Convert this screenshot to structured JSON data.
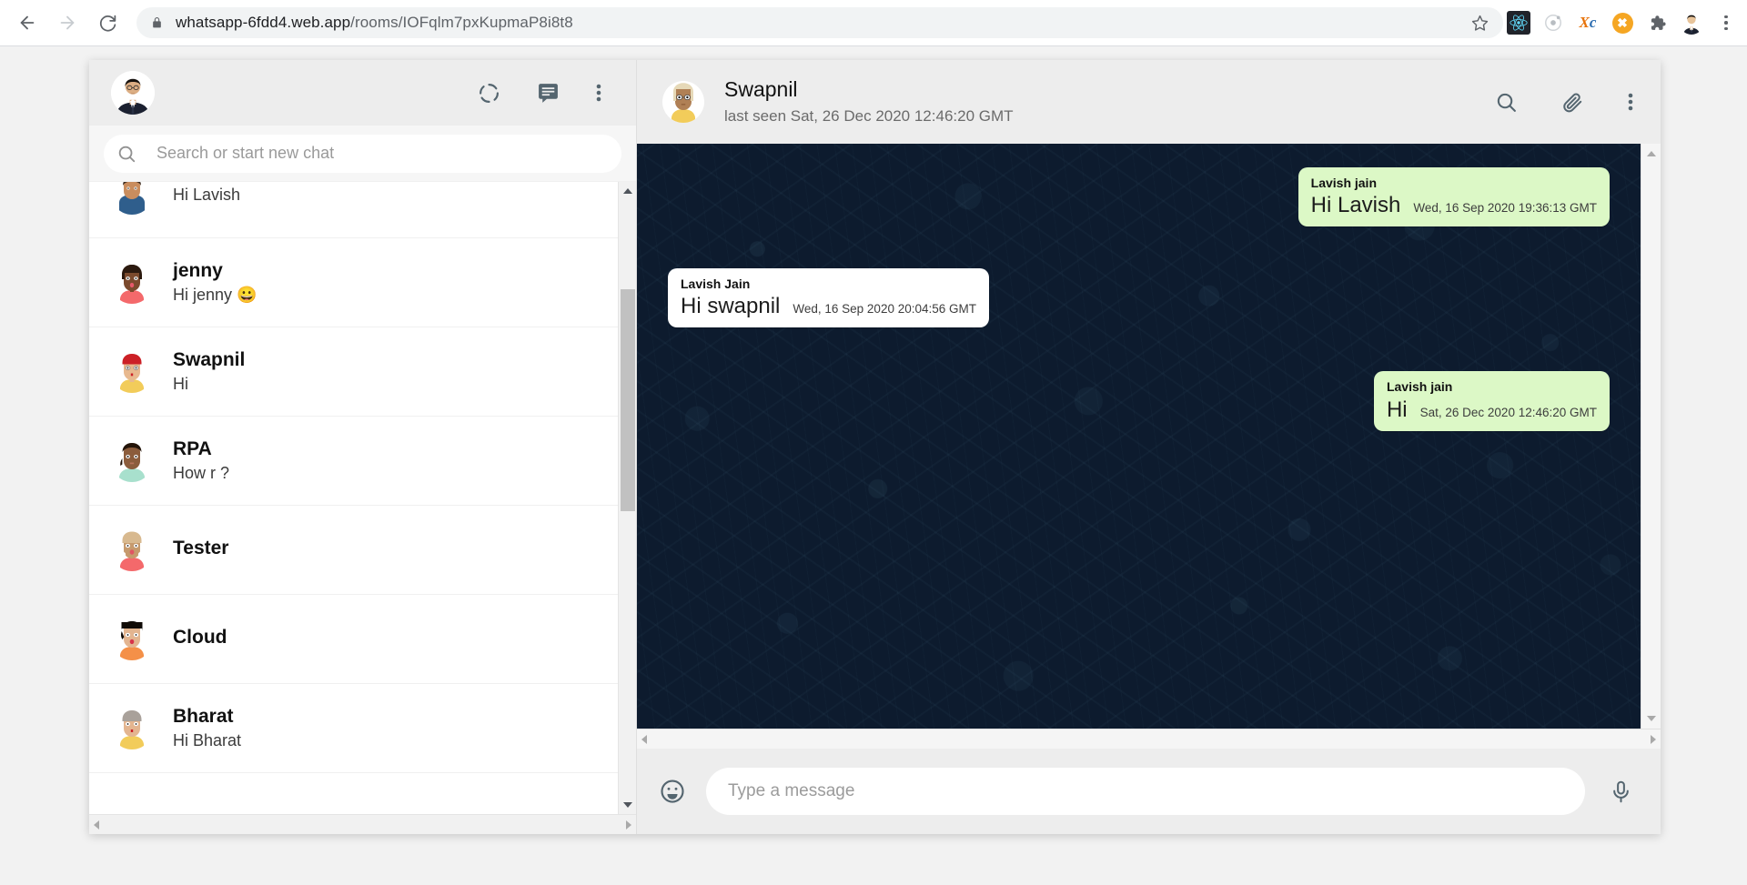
{
  "browser": {
    "back_label": "back-arrow",
    "forward_label": "forward-arrow",
    "reload_label": "reload",
    "url_display": "whatsapp-6fdd4.web.app",
    "url_path": "/rooms/IOFqlm7pxKupmaP8i8t8",
    "url_full": "whatsapp-6fdd4.web.app/rooms/IOFqlm7pxKupmaP8i8t8",
    "lock_icon": "lock-icon",
    "bookmark_icon": "star-icon",
    "extensions": [
      {
        "name": "react-devtools-icon",
        "glyph": "⚛"
      },
      {
        "name": "ionic-icon",
        "glyph": "◎"
      },
      {
        "name": "xc-extension-icon",
        "glyph": "Xc"
      },
      {
        "name": "orange-x-extension-icon",
        "glyph": "✖"
      },
      {
        "name": "puzzle-extensions-icon",
        "glyph": "❖"
      }
    ],
    "profile_icon": "user-avatar-icon",
    "menu_icon": "browser-menu-icon"
  },
  "sidebar": {
    "profile_avatar": "my-profile-avatar",
    "actions": [
      {
        "name": "status-icon",
        "label": "Status"
      },
      {
        "name": "new-chat-icon",
        "label": "New chat"
      },
      {
        "name": "menu-icon",
        "label": "Menu"
      }
    ],
    "search": {
      "icon": "search-icon",
      "placeholder": "Search or start new chat",
      "value": ""
    },
    "chats": [
      {
        "name": "",
        "message": "Hi Lavish",
        "avatar": "partial-avatar"
      },
      {
        "name": "jenny",
        "message": "Hi jenny 😀",
        "avatar": "jenny-avatar"
      },
      {
        "name": "Swapnil",
        "message": "Hi",
        "avatar": "swapnil-avatar"
      },
      {
        "name": "RPA",
        "message": "How r ?",
        "avatar": "rpa-avatar"
      },
      {
        "name": "Tester",
        "message": "",
        "avatar": "tester-avatar"
      },
      {
        "name": "Cloud",
        "message": "",
        "avatar": "cloud-avatar"
      },
      {
        "name": "Bharat",
        "message": "Hi Bharat",
        "avatar": "bharat-avatar"
      }
    ]
  },
  "chat": {
    "header": {
      "avatar": "swapnil-avatar",
      "title": "Swapnil",
      "subtitle": "last seen Sat, 26 Dec 2020 12:46:20 GMT",
      "actions": [
        {
          "name": "search-icon",
          "label": "Search"
        },
        {
          "name": "attachment-icon",
          "label": "Attach"
        },
        {
          "name": "menu-icon",
          "label": "Menu"
        }
      ]
    },
    "messages": [
      {
        "sender": "Lavish jain",
        "text": "Hi Lavish",
        "time": "Wed, 16 Sep 2020 19:36:13 GMT",
        "direction": "out"
      },
      {
        "sender": "Lavish Jain",
        "text": "Hi swapnil",
        "time": "Wed, 16 Sep 2020 20:04:56 GMT",
        "direction": "in"
      },
      {
        "sender": "Lavish jain",
        "text": "Hi",
        "time": "Sat, 26 Dec 2020 12:46:20 GMT",
        "direction": "out"
      }
    ],
    "composer": {
      "emoji_icon": "emoji-icon",
      "placeholder": "Type a message",
      "value": "",
      "mic_icon": "microphone-icon"
    }
  },
  "colors": {
    "outgoing_bubble": "#dcf8c6",
    "incoming_bubble": "#ffffff",
    "chat_background": "#0d1b2e",
    "header_bar": "#ededed",
    "accent": "#00bfa5"
  }
}
